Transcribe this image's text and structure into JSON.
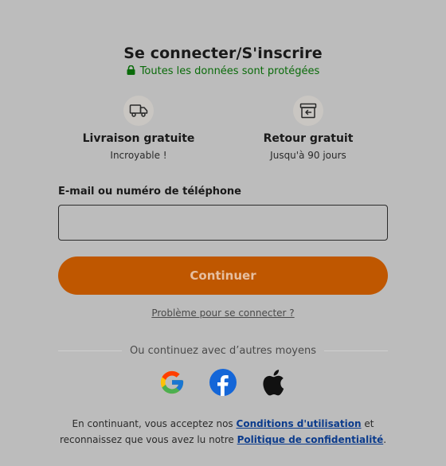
{
  "header": {
    "title": "Se connecter/S'inscrire",
    "secure_text": "Toutes les données sont protégées"
  },
  "benefits": [
    {
      "icon": "truck-icon",
      "title": "Livraison gratuite",
      "subtitle": "Incroyable !"
    },
    {
      "icon": "return-box-icon",
      "title": "Retour gratuit",
      "subtitle": "Jusqu'à 90 jours"
    }
  ],
  "form": {
    "field_label": "E-mail ou numéro de téléphone",
    "field_value": "",
    "continue_label": "Continuer",
    "trouble_link": "Problème pour se connecter ?"
  },
  "divider": {
    "text": "Ou continuez avec d’autres moyens"
  },
  "social": [
    {
      "name": "google-icon"
    },
    {
      "name": "facebook-icon"
    },
    {
      "name": "apple-icon"
    }
  ],
  "legal": {
    "line1_prefix": "En continuant, vous acceptez nos",
    "terms_link": "Conditions d'utilisation",
    "line1_suffix": "et",
    "line2_prefix": "reconnaissez que vous avez lu notre",
    "privacy_link": "Politique de confidentialité",
    "line2_suffix": "."
  },
  "colors": {
    "background": "#bcbcbc",
    "accent": "#bf5700",
    "secure_green": "#0a6b0a",
    "link_blue": "#0b3b8c"
  }
}
